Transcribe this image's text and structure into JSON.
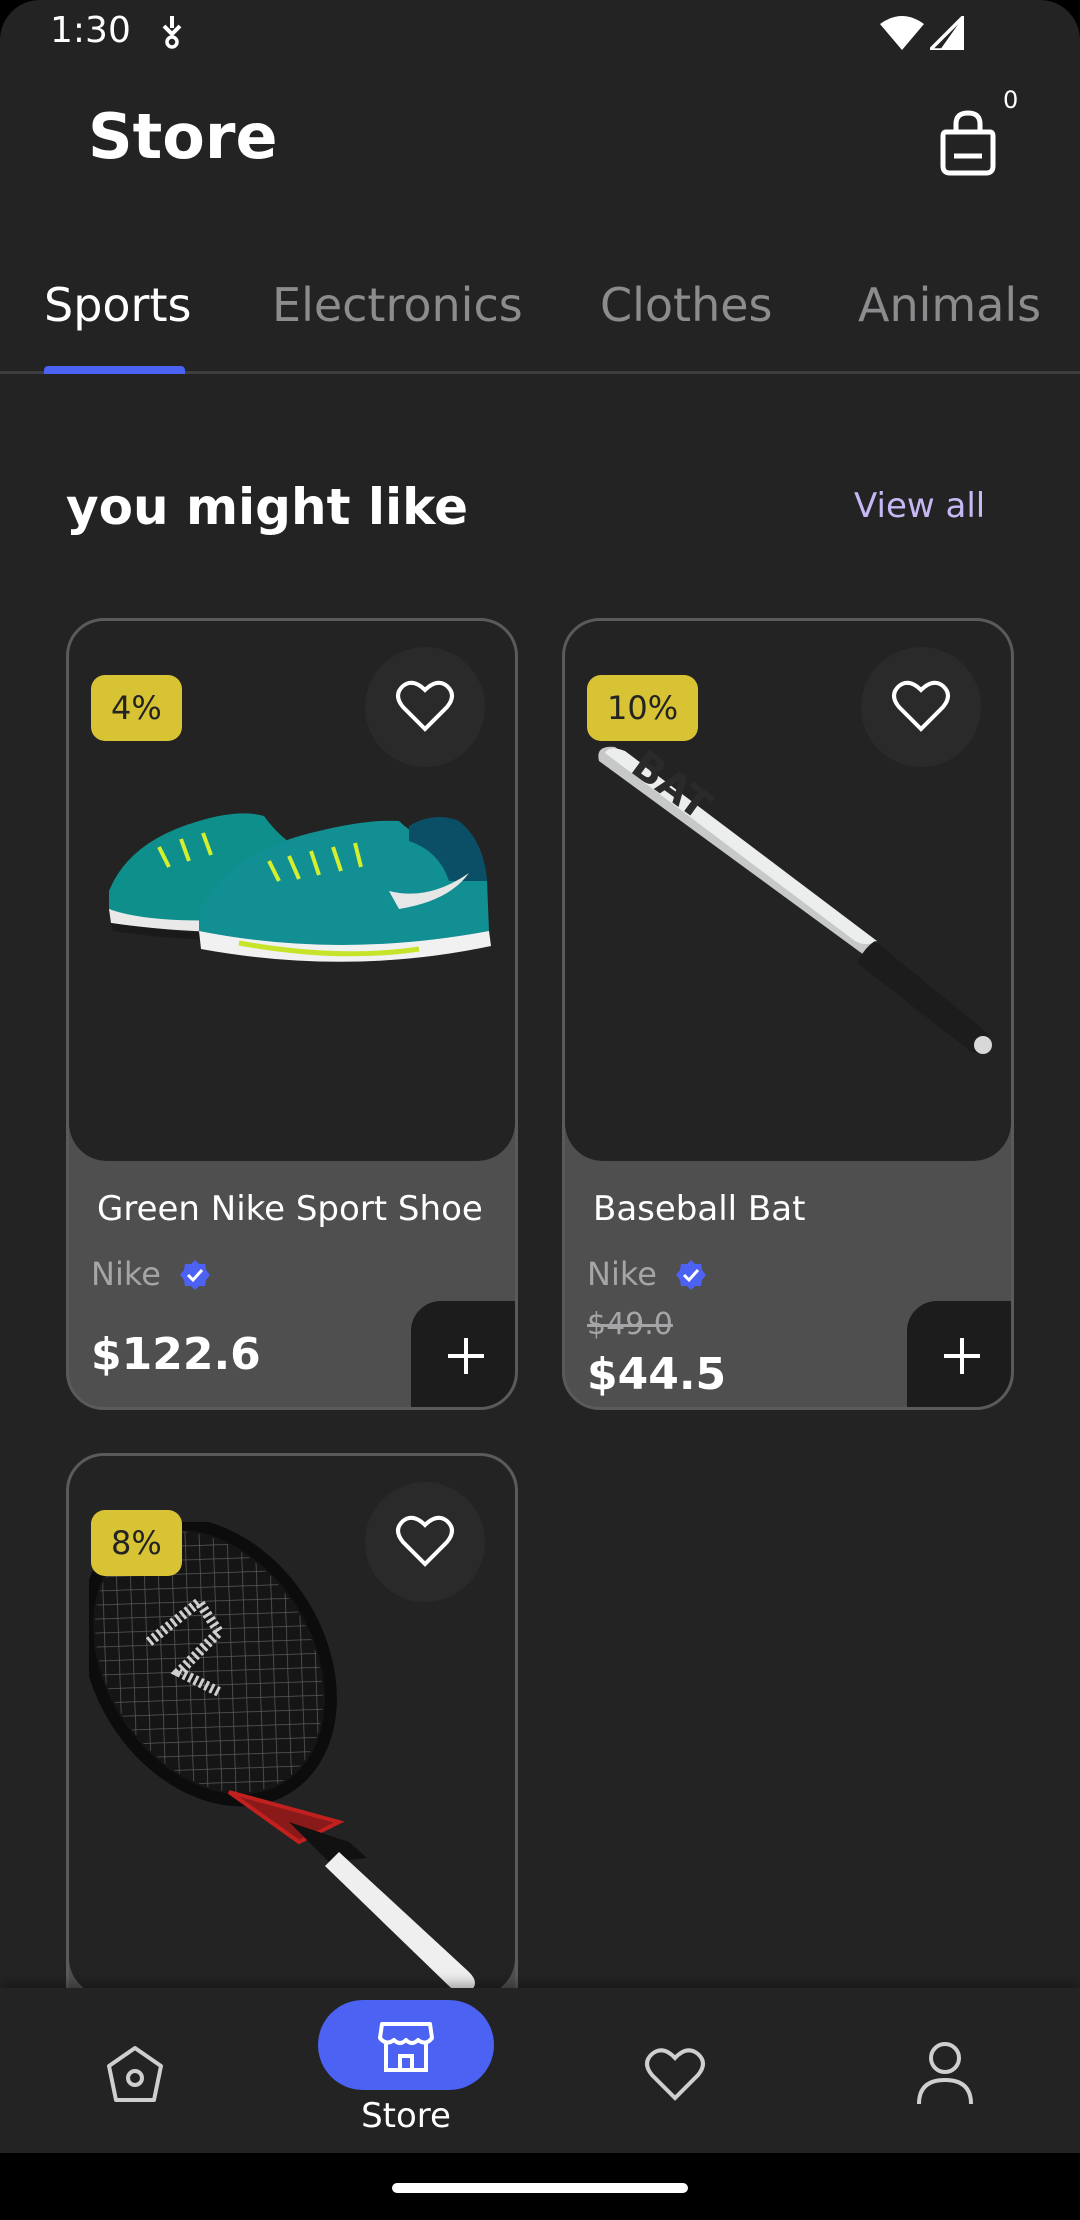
{
  "status_bar": {
    "time": "1:30"
  },
  "header": {
    "title": "Store",
    "cart_count": "0"
  },
  "tabs": [
    {
      "label": "Sports",
      "active": true
    },
    {
      "label": "Electronics",
      "active": false
    },
    {
      "label": "Clothes",
      "active": false
    },
    {
      "label": "Animals",
      "active": false
    }
  ],
  "section": {
    "title": "you might like",
    "view_all": "View all"
  },
  "products": [
    {
      "discount": "4%",
      "name": "Green Nike Sport Shoe",
      "brand": "Nike",
      "price": "$122.6",
      "old_price": ""
    },
    {
      "discount": "10%",
      "name": "Baseball Bat",
      "brand": "Nike",
      "price": "$44.5",
      "old_price": "$49.0"
    },
    {
      "discount": "8%",
      "name": "",
      "brand": "",
      "price": "",
      "old_price": ""
    }
  ],
  "bottom_nav": {
    "active_label": "Store"
  },
  "colors": {
    "accent": "#4b62f3",
    "badge": "#d8c335",
    "background": "#232324",
    "card": "#4f4f50",
    "verified": "#4b62f3"
  }
}
